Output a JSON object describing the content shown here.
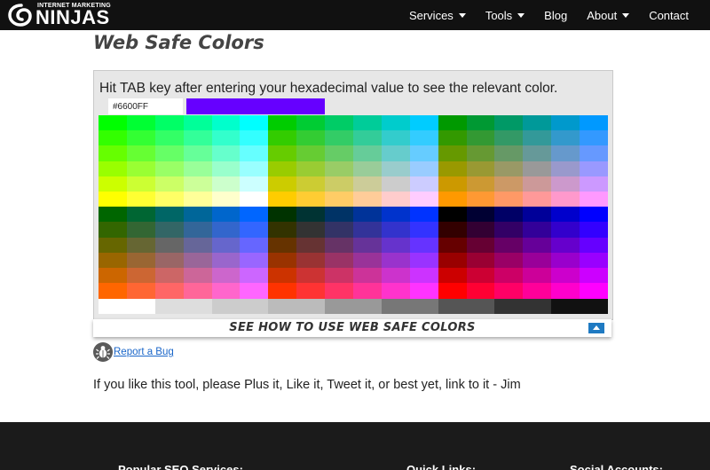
{
  "nav": {
    "logo_small": "INTERNET MARKETING",
    "logo_big": "NINJAS",
    "items": [
      {
        "label": "Services",
        "dropdown": true
      },
      {
        "label": "Tools",
        "dropdown": true
      },
      {
        "label": "Blog",
        "dropdown": false
      },
      {
        "label": "About",
        "dropdown": true
      },
      {
        "label": "Contact",
        "dropdown": false
      }
    ]
  },
  "page": {
    "title": "Web Safe Colors"
  },
  "tool": {
    "instruction": "Hit TAB key after entering your hexadecimal value to see the relevant color.",
    "hex_value": "#6600FF",
    "preview_color": "#6600FF",
    "grays": [
      "#FFFFFF",
      "#CCCCCC",
      "#999999",
      "#666666",
      "#333333",
      "#000000"
    ]
  },
  "howto": {
    "label": "SEE HOW TO USE WEB SAFE COLORS"
  },
  "bug": {
    "label": "Report a Bug"
  },
  "promo": {
    "text": "If you like this tool, please Plus it, Like it, Tweet it, or best yet, link to it - Jim"
  },
  "footer": {
    "headings": [
      "Popular SEO Services:",
      "Quick Links:",
      "Social Accounts:"
    ]
  },
  "colors": {
    "nav_bg": "#111111",
    "link": "#1a66c9",
    "toggle": "#1f7ac2",
    "footer_bg": "#1b1b1b"
  }
}
